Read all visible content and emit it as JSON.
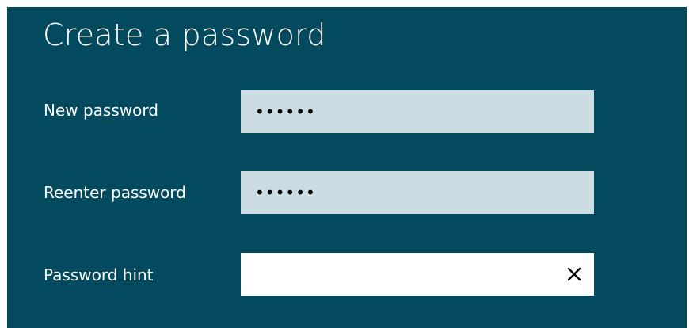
{
  "dialog": {
    "title": "Create a password",
    "fields": [
      {
        "label": "New password",
        "value": "••••••",
        "type": "password"
      },
      {
        "label": "Reenter password",
        "value": "••••••",
        "type": "password"
      },
      {
        "label": "Password hint",
        "value": "",
        "type": "text"
      }
    ]
  },
  "icons": {
    "clear": "close-icon"
  },
  "colors": {
    "panel_bg": "#044a5e",
    "filled_field_bg": "#cbdde3",
    "empty_field_bg": "#ffffff",
    "text": "#ffffff"
  }
}
